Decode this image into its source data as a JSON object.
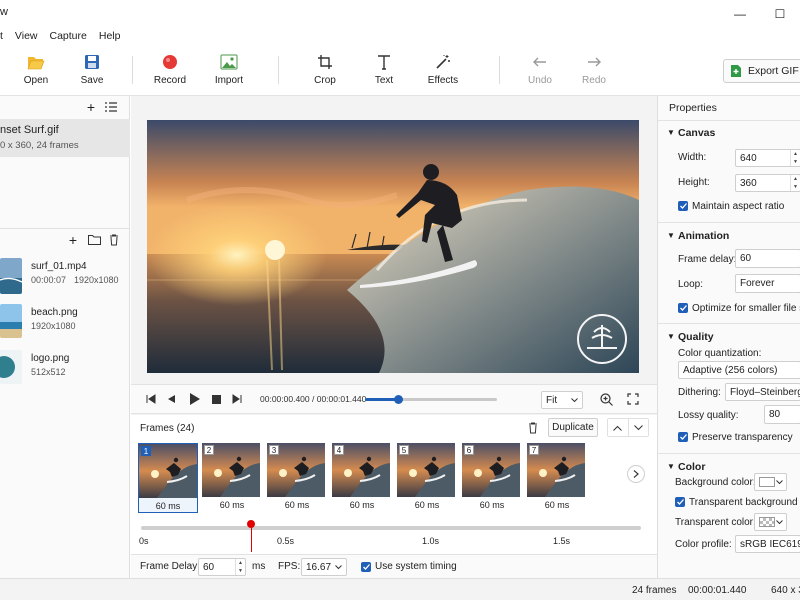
{
  "window": {
    "title_fragment": "w",
    "minimize": "—",
    "maximize": "☐"
  },
  "menu": [
    "t",
    "View",
    "Capture",
    "Help"
  ],
  "toolbar": {
    "open": "Open",
    "save": "Save",
    "record": "Record",
    "import": "Import",
    "crop": "Crop",
    "text": "Text",
    "effects": "Effects",
    "undo": "Undo",
    "redo": "Redo",
    "export": "Export GIF"
  },
  "project": {
    "name": "nset Surf.gif",
    "meta": "0 x 360, 24 frames"
  },
  "media": [
    {
      "name": "surf_01.mp4",
      "duration": "00:00:07",
      "size": "1920x1080"
    },
    {
      "name": "beach.png",
      "size": "1920x1080"
    },
    {
      "name": "logo.png",
      "size": "512x512"
    }
  ],
  "player": {
    "time": "00:00:00.400 / 00:00:01.440",
    "zoom": "Fit",
    "progress": 0.25
  },
  "frames": {
    "header": "Frames (24)",
    "duplicate": "Duplicate",
    "items": [
      {
        "num": "1",
        "dur": "60 ms"
      },
      {
        "num": "2",
        "dur": "60 ms"
      },
      {
        "num": "3",
        "dur": "60 ms"
      },
      {
        "num": "4",
        "dur": "60 ms"
      },
      {
        "num": "5",
        "dur": "60 ms"
      },
      {
        "num": "6",
        "dur": "60 ms"
      },
      {
        "num": "7",
        "dur": "60 ms"
      }
    ]
  },
  "timeline": {
    "ticks": [
      "0s",
      "0.5s",
      "1.0s",
      "1.5s"
    ],
    "playhead_fraction": 0.22
  },
  "bottom": {
    "frame_delay_label": "Frame Delay:",
    "frame_delay_value": "60",
    "ms": "ms",
    "fps_label": "FPS:",
    "fps_value": "16.67",
    "system_timing": "Use system timing"
  },
  "properties": {
    "title": "Properties",
    "canvas": {
      "header": "Canvas",
      "width_label": "Width:",
      "width": "640",
      "height_label": "Height:",
      "height": "360",
      "aspect": "Maintain aspect ratio"
    },
    "animation": {
      "header": "Animation",
      "delay_label": "Frame delay:",
      "delay": "60",
      "loop_label": "Loop:",
      "loop": "Forever",
      "optimize": "Optimize for smaller file size"
    },
    "quality": {
      "header": "Quality",
      "quant_label": "Color quantization:",
      "quant": "Adaptive (256 colors)",
      "dither_label": "Dithering:",
      "dither": "Floyd–Steinberg",
      "lossy_label": "Lossy quality:",
      "lossy": "80",
      "transparency": "Preserve transparency"
    },
    "color": {
      "header": "Color",
      "bg_label": "Background color:",
      "transparent_bg": "Transparent background",
      "tcolor_label": "Transparent color:",
      "profile_label": "Color profile:",
      "profile": "sRGB IEC61966-"
    }
  },
  "status": {
    "frames": "24 frames",
    "duration": "00:00:01.440",
    "size": "640 x 3"
  },
  "colors": {
    "accent": "#1f5fb8",
    "record": "#e53935",
    "playhead": "#e00000"
  }
}
